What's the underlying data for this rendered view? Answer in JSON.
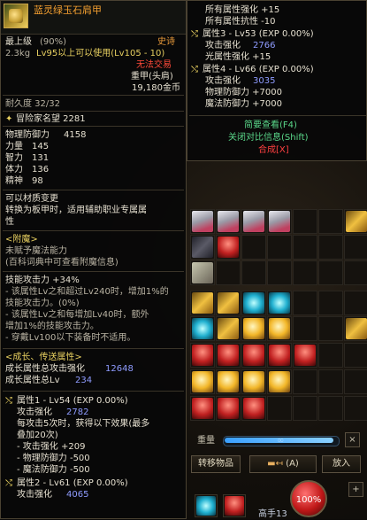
{
  "tooltip": {
    "item_name": "蓝灵绿玉石肩甲",
    "top_level_label": "最上级",
    "top_level_pct": "(90%)",
    "rarity": "史诗",
    "weight": "2.3kg",
    "level_req": "Lv95以上可以使用(Lv105 - 10)",
    "trade": "无法交易",
    "type": "重甲(头肩)",
    "price": "19,180金币",
    "durability": "耐久度 32/32",
    "reputation": "冒险家名望 2281",
    "stats": [
      {
        "label": "物理防御力",
        "value": "4158"
      },
      {
        "label": "力量",
        "value": "145"
      },
      {
        "label": "智力",
        "value": "131"
      },
      {
        "label": "体力",
        "value": "136"
      },
      {
        "label": "精神",
        "value": "98"
      }
    ],
    "material_change": "可以材质变更",
    "convert_line1": "转换为板甲时，适用辅助职业专属属",
    "convert_line2": "性",
    "enchant_header": "<附魔>",
    "enchant_none": "未赋予魔法能力",
    "enchant_hint": "(百科词典中可查看附魔信息)",
    "skill_attack": "技能攻击力 +34%",
    "skill_desc1": "- 该属性Lv之和超过Lv240时，增加1%的",
    "skill_desc2": "技能攻击力。(0%)",
    "skill_desc3": "- 该属性Lv之和每增加Lv40时，额外",
    "skill_desc4": "增加1%的技能攻击力。",
    "skill_desc5": "- 穿戴Lv100以下装备时不适用。",
    "growth_header": "<成长、传送属性>",
    "growth_total_attack_label": "成长属性总攻击强化",
    "growth_total_attack_value": "12648",
    "growth_total_lv_label": "成长属性总Lv",
    "growth_total_lv_value": "234",
    "attr1_title": "属性1 - Lv54 (EXP 0.00%)",
    "attr1_attack_label": "攻击强化",
    "attr1_attack_value": "2782",
    "attr1_desc1": "每攻击5次时，获得以下效果(最多",
    "attr1_desc2": "叠加20次)",
    "attr1_eff1": "- 攻击强化 +209",
    "attr1_eff2": "- 物理防御力 -500",
    "attr1_eff3": "- 魔法防御力 -500",
    "attr2_title": "属性2 - Lv61 (EXP 0.00%)",
    "attr2_attack_label": "攻击强化",
    "attr2_attack_value": "4065"
  },
  "compare": {
    "line1": "所有属性强化 +15",
    "line2": "所有属性抗性 -10",
    "attr3_title": "属性3 - Lv53 (EXP 0.00%)",
    "attr3_attack_label": "攻击强化",
    "attr3_attack_value": "2766",
    "attr3_light": "光属性强化 +15",
    "attr4_title": "属性4 - Lv66 (EXP 0.00%)",
    "attr4_attack_label": "攻击强化",
    "attr4_attack_value": "3035",
    "attr4_pdef": "物理防御力 +7000",
    "attr4_mdef": "魔法防御力 +7000",
    "brief_view": "简要查看(F4)",
    "close_compare": "关闭对比信息(Shift)",
    "compose": "合成[X]"
  },
  "inventory": {
    "weight_label": "重量",
    "weight_value": "∞",
    "weight_fill_fraction": 0.98,
    "transfer_button": "转移物品",
    "arrange_button": "(A)",
    "put_in_button": "放入",
    "arrange_icon": "arrange-icon",
    "close_glyph": "×",
    "plus_glyph": "+"
  },
  "hud": {
    "hp_pct": "100%",
    "level_label": "高手13"
  },
  "colors": {
    "epic": "#f5a030",
    "attr_blue": "#8f9cff",
    "compare_green": "#5ad88a",
    "compose_red": "#ff4040"
  }
}
